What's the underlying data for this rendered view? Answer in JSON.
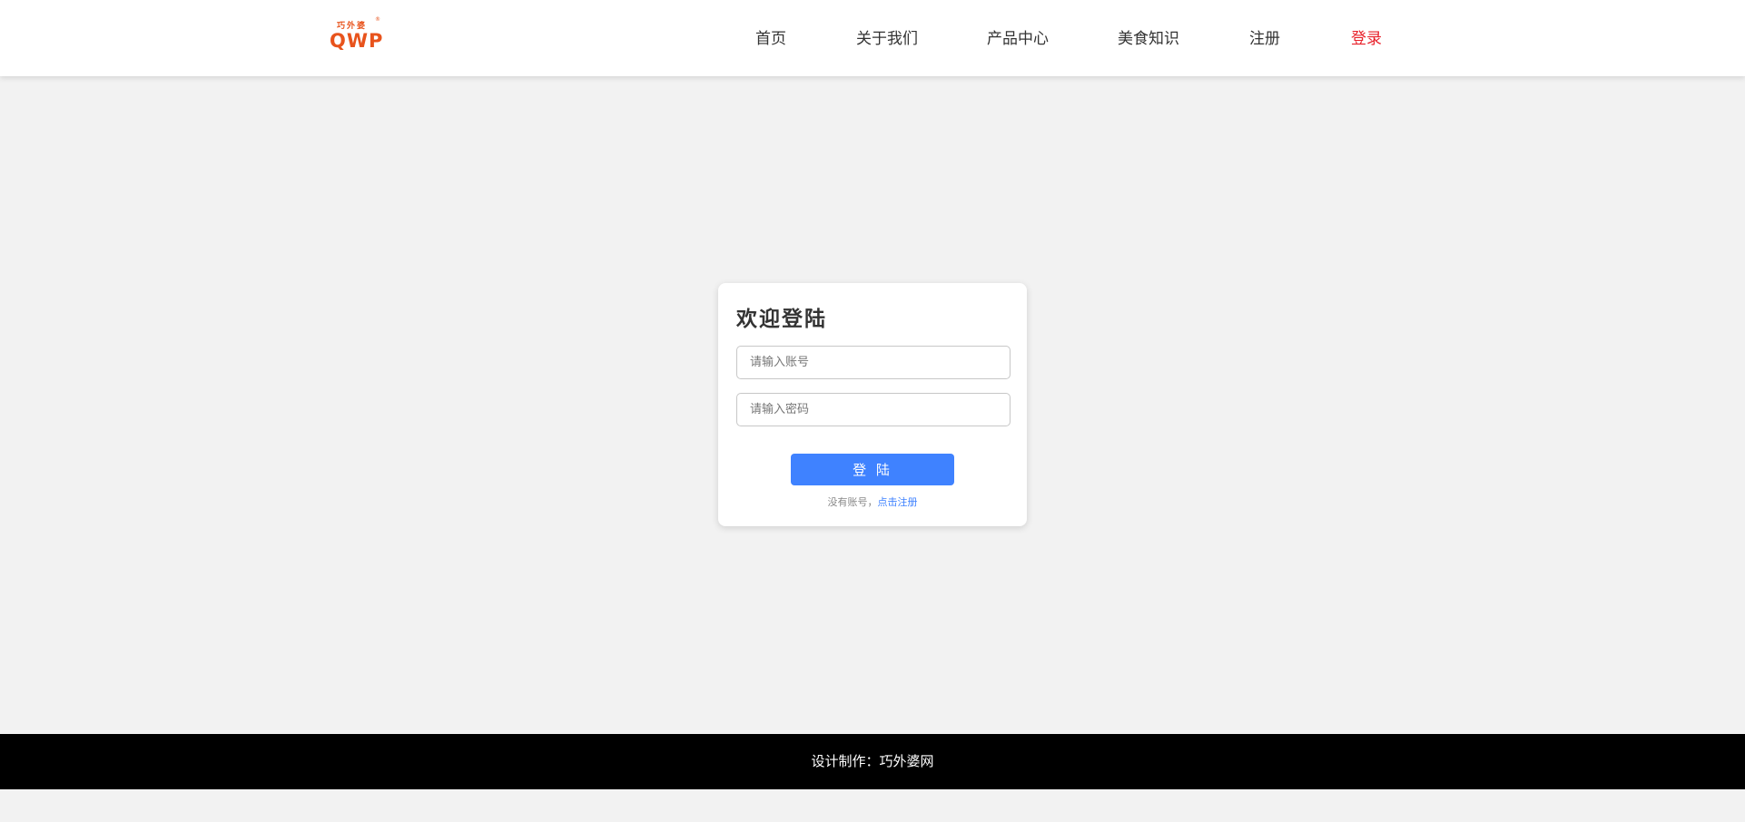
{
  "brand": {
    "logo_small": "巧外婆",
    "logo_mark": "®",
    "logo_big": "QWP",
    "color": "#e8531c"
  },
  "nav": {
    "items": [
      {
        "label": "首页"
      },
      {
        "label": "关于我们"
      },
      {
        "label": "产品中心"
      },
      {
        "label": "美食知识"
      },
      {
        "label": "注册"
      },
      {
        "label": "登录",
        "active": true
      }
    ],
    "active_color": "#e8202a"
  },
  "login": {
    "title": "欢迎登陆",
    "account_placeholder": "请输入账号",
    "password_placeholder": "请输入密码",
    "submit_label": "登 陆",
    "no_account_text": "没有账号，",
    "register_link": "点击注册",
    "button_color": "#3f82ff"
  },
  "footer": {
    "text": "设计制作：巧外婆网"
  }
}
